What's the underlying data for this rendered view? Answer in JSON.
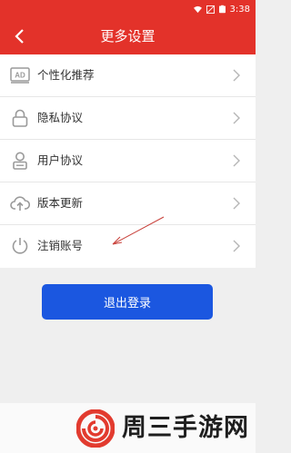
{
  "status_bar": {
    "time": "3:38",
    "icons": [
      "wifi-icon",
      "signal-icon",
      "battery-icon"
    ]
  },
  "header": {
    "title": "更多设置",
    "back_icon": "chevron-left-icon"
  },
  "menu": {
    "items": [
      {
        "label": "个性化推荐",
        "icon": "ad-icon"
      },
      {
        "label": "隐私协议",
        "icon": "lock-icon"
      },
      {
        "label": "用户协议",
        "icon": "user-icon"
      },
      {
        "label": "版本更新",
        "icon": "cloud-upload-icon"
      },
      {
        "label": "注销账号",
        "icon": "power-icon"
      }
    ]
  },
  "logout_button": {
    "label": "退出登录"
  },
  "watermark": {
    "text": "周三手游网"
  },
  "colors": {
    "header_bg": "#e3322a",
    "button_bg": "#1b57e0",
    "page_bg": "#efefef"
  }
}
